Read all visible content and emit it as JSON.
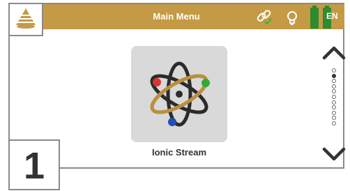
{
  "header": {
    "title": "Main Menu",
    "lang": "EN",
    "icons": [
      "logo-icon",
      "link-icon",
      "lightbulb-icon",
      "battery-icon"
    ]
  },
  "screen_number": "1",
  "menu": {
    "current_item_label": "Ionic Stream",
    "current_item_icon": "atom-icon",
    "page_index": 2,
    "page_count": 11
  },
  "colors": {
    "header": "#c59a45",
    "battery": "#2e8b2e",
    "link_check": "#3cb43c",
    "tile": "#d9d9d9"
  }
}
